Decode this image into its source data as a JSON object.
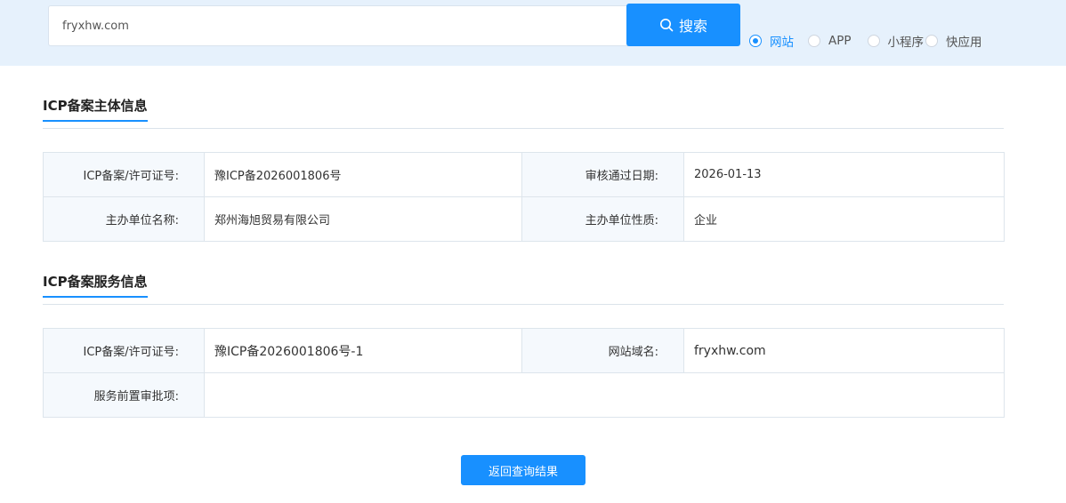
{
  "search": {
    "value": "fryxhw.com",
    "button_label": "搜索"
  },
  "search_types": [
    {
      "label": "网站",
      "selected": true
    },
    {
      "label": "APP",
      "selected": false
    },
    {
      "label": "小程序",
      "selected": false
    },
    {
      "label": "快应用",
      "selected": false
    }
  ],
  "subject_info": {
    "title": "ICP备案主体信息",
    "rows": [
      {
        "label1": "ICP备案/许可证号:",
        "value1": "豫ICP备2026001806号",
        "label2": "审核通过日期:",
        "value2": "2026-01-13"
      },
      {
        "label1": "主办单位名称:",
        "value1": "郑州海旭贸易有限公司",
        "label2": "主办单位性质:",
        "value2": "企业"
      }
    ]
  },
  "service_info": {
    "title": "ICP备案服务信息",
    "license_label": "ICP备案/许可证号:",
    "license_value": "豫ICP备2026001806号-1",
    "domain_label": "网站域名:",
    "domain_value": "fryxhw.com",
    "approval_label": "服务前置审批项:",
    "approval_value": ""
  },
  "back_button_label": "返回查询结果",
  "colors": {
    "accent": "#1890ff",
    "top_band": "#e6f1fc",
    "label_cell": "#f5f9fd"
  }
}
